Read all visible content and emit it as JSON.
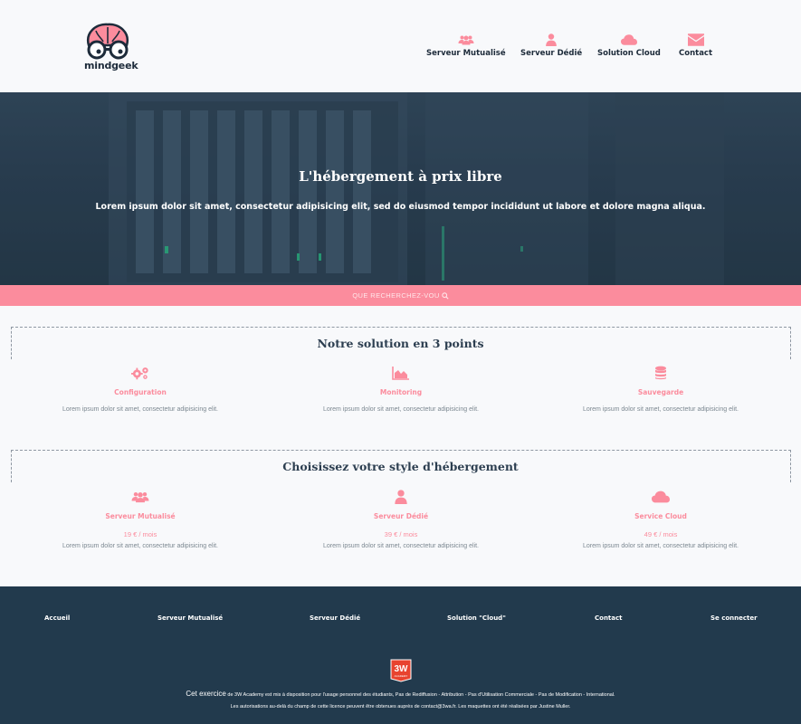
{
  "brand": {
    "name": "mindgeek"
  },
  "nav": [
    {
      "label": "Serveur Mutualisé",
      "icon": "users-icon"
    },
    {
      "label": "Serveur Dédié",
      "icon": "user-icon"
    },
    {
      "label": "Solution Cloud",
      "icon": "cloud-icon"
    },
    {
      "label": "Contact",
      "icon": "envelope-icon"
    }
  ],
  "hero": {
    "title": "L'hébergement à prix libre",
    "subtitle": "Lorem ipsum dolor sit amet, consectetur adipisicing elit, sed do eiusmod tempor incididunt ut labore et dolore magna aliqua."
  },
  "search": {
    "placeholder": "QUE RECHERCHEZ-VOU"
  },
  "features": {
    "title": "Notre solution en 3 points",
    "items": [
      {
        "icon": "cogs-icon",
        "title": "Configuration",
        "text": "Lorem ipsum dolor sit amet, consectetur adipisicing elit."
      },
      {
        "icon": "area-chart-icon",
        "title": "Monitoring",
        "text": "Lorem ipsum dolor sit amet, consectetur adipisicing elit."
      },
      {
        "icon": "database-icon",
        "title": "Sauvegarde",
        "text": "Lorem ipsum dolor sit amet, consectetur adipisicing elit."
      }
    ]
  },
  "plans": {
    "title": "Choisissez votre style d'hébergement",
    "items": [
      {
        "icon": "users-icon",
        "title": "Serveur Mutualisé",
        "price": "19 € / mois",
        "text": "Lorem ipsum dolor sit amet, consectetur adipisicing elit."
      },
      {
        "icon": "user-icon",
        "title": "Serveur Dédié",
        "price": "39 € / mois",
        "text": "Lorem ipsum dolor sit amet, consectetur adipisicing elit."
      },
      {
        "icon": "cloud-icon",
        "title": "Service Cloud",
        "price": "49 € / mois",
        "text": "Lorem ipsum dolor sit amet, consectetur adipisicing elit."
      }
    ]
  },
  "footer": {
    "links": [
      "Accueil",
      "Serveur Mutualisé",
      "Serveur Dédié",
      "Solution \"Cloud\"",
      "Contact",
      "Se connecter"
    ],
    "badge": "3W",
    "badge_sub": "ACADEMY",
    "line1_lead": "Cet exercice",
    "line1_rest": " de 3W Academy est mis à disposition pour l'usage personnel des étudiants, Pas de Rediffusion - Attribution - Pas d'Utilisation Commerciale - Pas de Modification - International.",
    "line2": "Les autorisations au-delà du champ de cette licence peuvent être obtenues auprès de contact@3wa.fr. Les maquettes ont été réalisées par Justine Muller."
  },
  "colors": {
    "accent": "#fb8c9d",
    "dark": "#223a4d",
    "text": "#2c3e50",
    "background": "#f8f9fb"
  }
}
